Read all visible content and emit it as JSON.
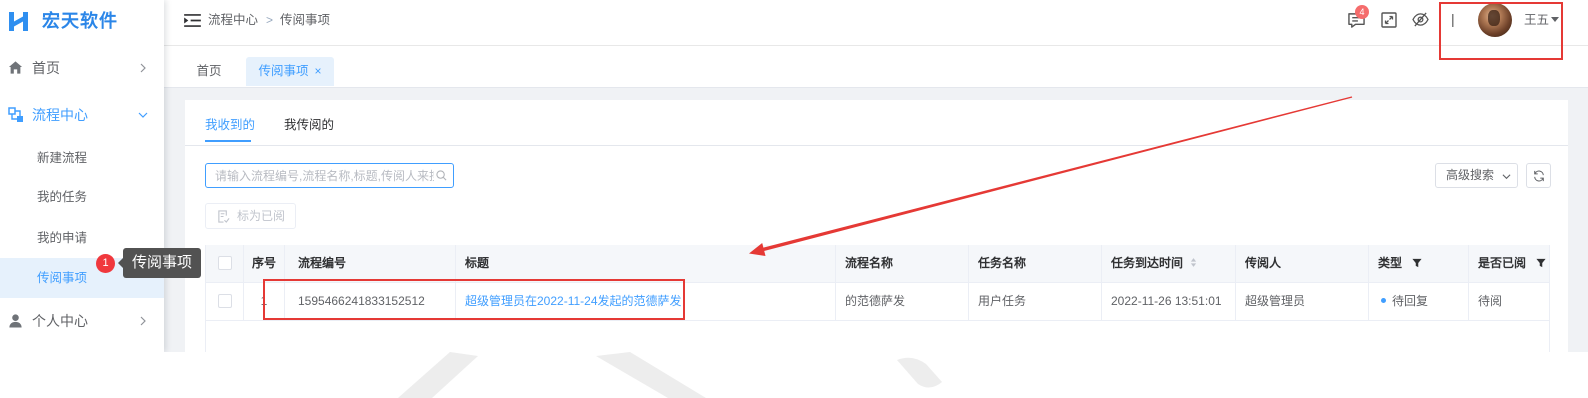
{
  "app": {
    "logo_text": "宏天软件",
    "logo_icon": "logo-h-icon"
  },
  "sidebar": {
    "home": {
      "label": "首页",
      "icon": "home-icon"
    },
    "flow_center": {
      "label": "流程中心",
      "icon": "flow-icon"
    },
    "sub_items": [
      {
        "label": "新建流程"
      },
      {
        "label": "我的任务"
      },
      {
        "label": "我的申请"
      },
      {
        "label": "传阅事项"
      }
    ],
    "personal": {
      "label": "个人中心",
      "icon": "user-icon"
    }
  },
  "tooltip": {
    "badge": "1",
    "text": "传阅事项"
  },
  "header": {
    "breadcrumb": [
      {
        "label": "流程中心"
      },
      {
        "label": "传阅事项"
      }
    ],
    "breadcrumb_separator": ">",
    "message_count": "4",
    "divider": "|",
    "user_name": "王五"
  },
  "page_tabs": [
    {
      "label": "首页"
    },
    {
      "label": "传阅事项",
      "close": "×"
    }
  ],
  "sub_tabs": [
    {
      "label": "我收到的"
    },
    {
      "label": "我传阅的"
    }
  ],
  "search": {
    "placeholder": "请输入流程编号,流程名称,标题,传阅人来搜索"
  },
  "toolbar": {
    "advanced_search": "高级搜索",
    "mark_read": "标为已阅"
  },
  "table": {
    "columns": [
      "序号",
      "流程编号",
      "标题",
      "流程名称",
      "任务名称",
      "任务到达时间",
      "传阅人",
      "类型",
      "是否已阅"
    ],
    "rows": [
      {
        "index": "1",
        "process_no": "1595466241833152512",
        "title": "超级管理员在2022-11-24发起的范德萨发",
        "process_name": "的范德萨发",
        "task_name": "用户任务",
        "arrival_time": "2022-11-26 13:51:01",
        "sender": "超级管理员",
        "type": "待回复",
        "read_status": "待阅"
      }
    ]
  },
  "colors": {
    "primary": "#409eff",
    "annotation_red": "#e53935",
    "badge_red": "#f56c6c",
    "tooltip_bg": "#525252",
    "page_bg": "#f0f2f5"
  }
}
